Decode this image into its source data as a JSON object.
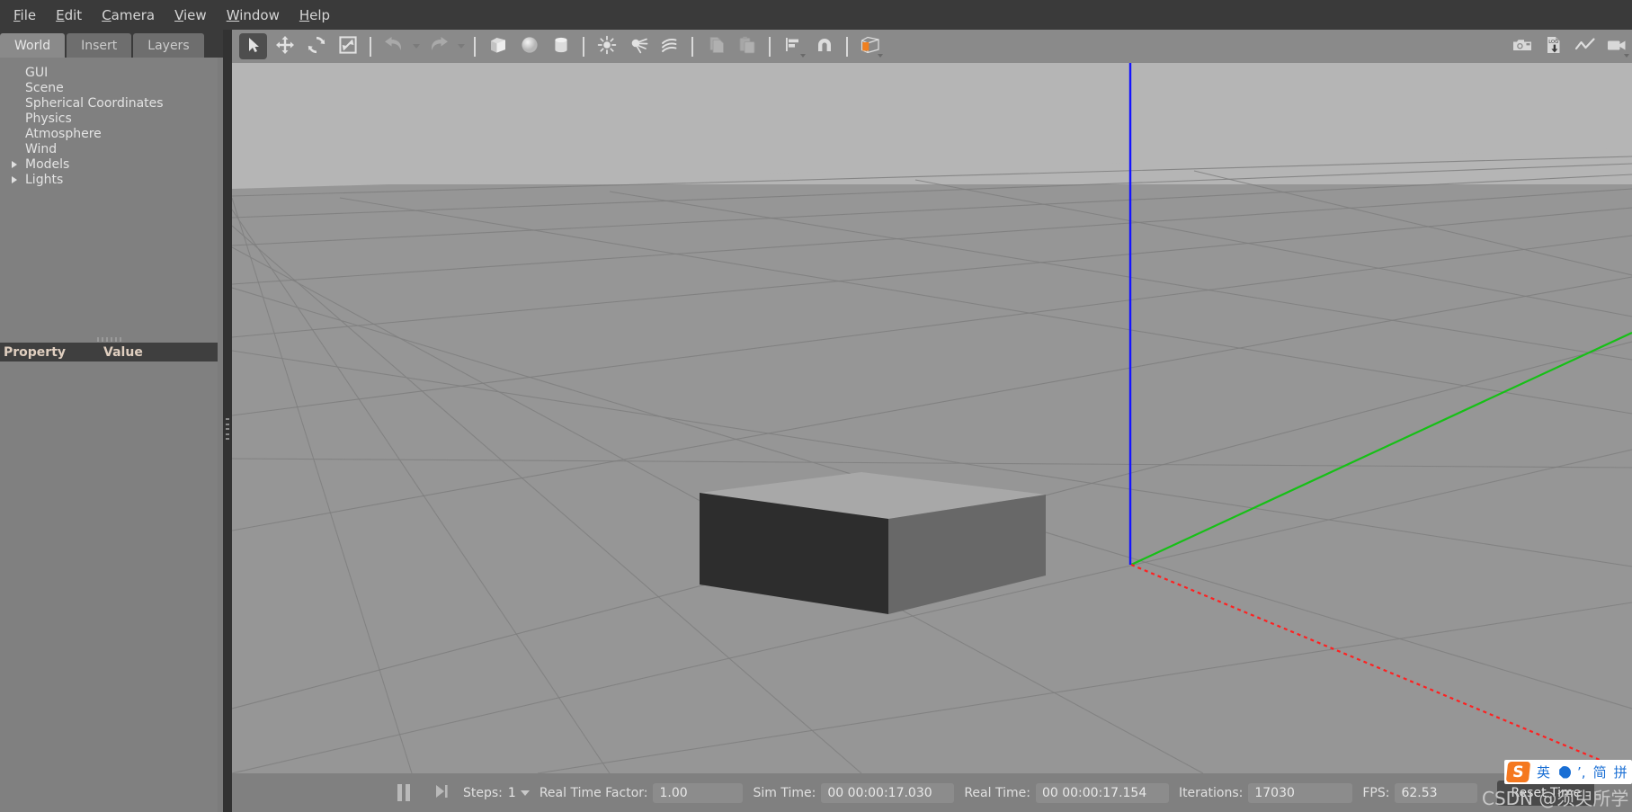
{
  "app": {
    "title": "Gazebo"
  },
  "menubar": {
    "items": [
      {
        "label": "File",
        "mnemonic": "F"
      },
      {
        "label": "Edit",
        "mnemonic": "E"
      },
      {
        "label": "Camera",
        "mnemonic": "C"
      },
      {
        "label": "View",
        "mnemonic": "V"
      },
      {
        "label": "Window",
        "mnemonic": "W"
      },
      {
        "label": "Help",
        "mnemonic": "H"
      }
    ]
  },
  "left_panel": {
    "tabs": [
      {
        "label": "World",
        "active": true
      },
      {
        "label": "Insert",
        "active": false
      },
      {
        "label": "Layers",
        "active": false
      }
    ],
    "tree_items": [
      {
        "label": "GUI",
        "expandable": false
      },
      {
        "label": "Scene",
        "expandable": false
      },
      {
        "label": "Spherical Coordinates",
        "expandable": false
      },
      {
        "label": "Physics",
        "expandable": false
      },
      {
        "label": "Atmosphere",
        "expandable": false
      },
      {
        "label": "Wind",
        "expandable": false
      },
      {
        "label": "Models",
        "expandable": true
      },
      {
        "label": "Lights",
        "expandable": true
      }
    ],
    "property_table": {
      "columns": [
        "Property",
        "Value"
      ],
      "rows": []
    }
  },
  "toolbar": {
    "left_tools": [
      {
        "name": "select-mode",
        "icon": "arrow-cursor-icon",
        "active": true
      },
      {
        "name": "translate-mode",
        "icon": "move-arrows-icon",
        "active": false
      },
      {
        "name": "rotate-mode",
        "icon": "rotate-icon",
        "active": false
      },
      {
        "name": "scale-mode",
        "icon": "scale-icon",
        "active": false
      }
    ],
    "history_tools": [
      {
        "name": "undo",
        "icon": "undo-arrow-icon"
      },
      {
        "name": "redo",
        "icon": "redo-arrow-icon"
      }
    ],
    "shape_tools": [
      {
        "name": "insert-box",
        "icon": "box-icon"
      },
      {
        "name": "insert-sphere",
        "icon": "sphere-icon"
      },
      {
        "name": "insert-cylinder",
        "icon": "cylinder-icon"
      }
    ],
    "light_tools": [
      {
        "name": "insert-point-light",
        "icon": "point-light-icon"
      },
      {
        "name": "insert-spot-light",
        "icon": "spot-light-icon"
      },
      {
        "name": "insert-directional-light",
        "icon": "directional-light-icon"
      }
    ],
    "clipboard_tools": [
      {
        "name": "copy",
        "icon": "copy-icon"
      },
      {
        "name": "paste",
        "icon": "paste-icon"
      }
    ],
    "align_tools": [
      {
        "name": "align",
        "icon": "align-icon"
      },
      {
        "name": "snap",
        "icon": "magnet-snap-icon"
      }
    ],
    "view_tools": [
      {
        "name": "view-angle",
        "icon": "view-cube-icon",
        "accent": "#f08020"
      }
    ],
    "right_tools": [
      {
        "name": "screenshot",
        "icon": "camera-icon"
      },
      {
        "name": "log-record",
        "icon": "log-download-icon"
      },
      {
        "name": "plot-window",
        "icon": "plot-line-icon"
      },
      {
        "name": "video-record",
        "icon": "video-camera-icon"
      }
    ]
  },
  "viewport": {
    "sky_color": "#b5b5b5",
    "ground_color": "#969696",
    "grid_color": "#7e7e7e",
    "axes": [
      {
        "name": "z-axis",
        "color": "#1414ff",
        "style": "solid"
      },
      {
        "name": "y-axis",
        "color": "#16c016",
        "style": "solid"
      },
      {
        "name": "x-axis",
        "color": "#ff2020",
        "style": "dotted"
      }
    ],
    "objects": [
      {
        "name": "unit-box",
        "faces": {
          "left": "#2d2d2d",
          "right": "#6b6b6b",
          "top": "#a8a8a8"
        }
      }
    ]
  },
  "statusbar": {
    "pause_button": "pause-icon",
    "step_button": "step-forward-icon",
    "steps_label": "Steps:",
    "steps_value": "1",
    "rtf_label": "Real Time Factor:",
    "rtf_value": "1.00",
    "sim_time_label": "Sim Time:",
    "sim_time_value": "00 00:00:17.030",
    "real_time_label": "Real Time:",
    "real_time_value": "00 00:00:17.154",
    "iterations_label": "Iterations:",
    "iterations_value": "17030",
    "fps_label": "FPS:",
    "fps_value": "62.53",
    "reset_button": "Reset Time"
  },
  "ime_bar": {
    "logo": "S",
    "items": [
      "英",
      "简",
      "拼"
    ],
    "moon_icon": "moon-icon",
    "comma_icon": "comma-icon"
  },
  "watermark": {
    "text": "CSDN @须臾所学"
  }
}
